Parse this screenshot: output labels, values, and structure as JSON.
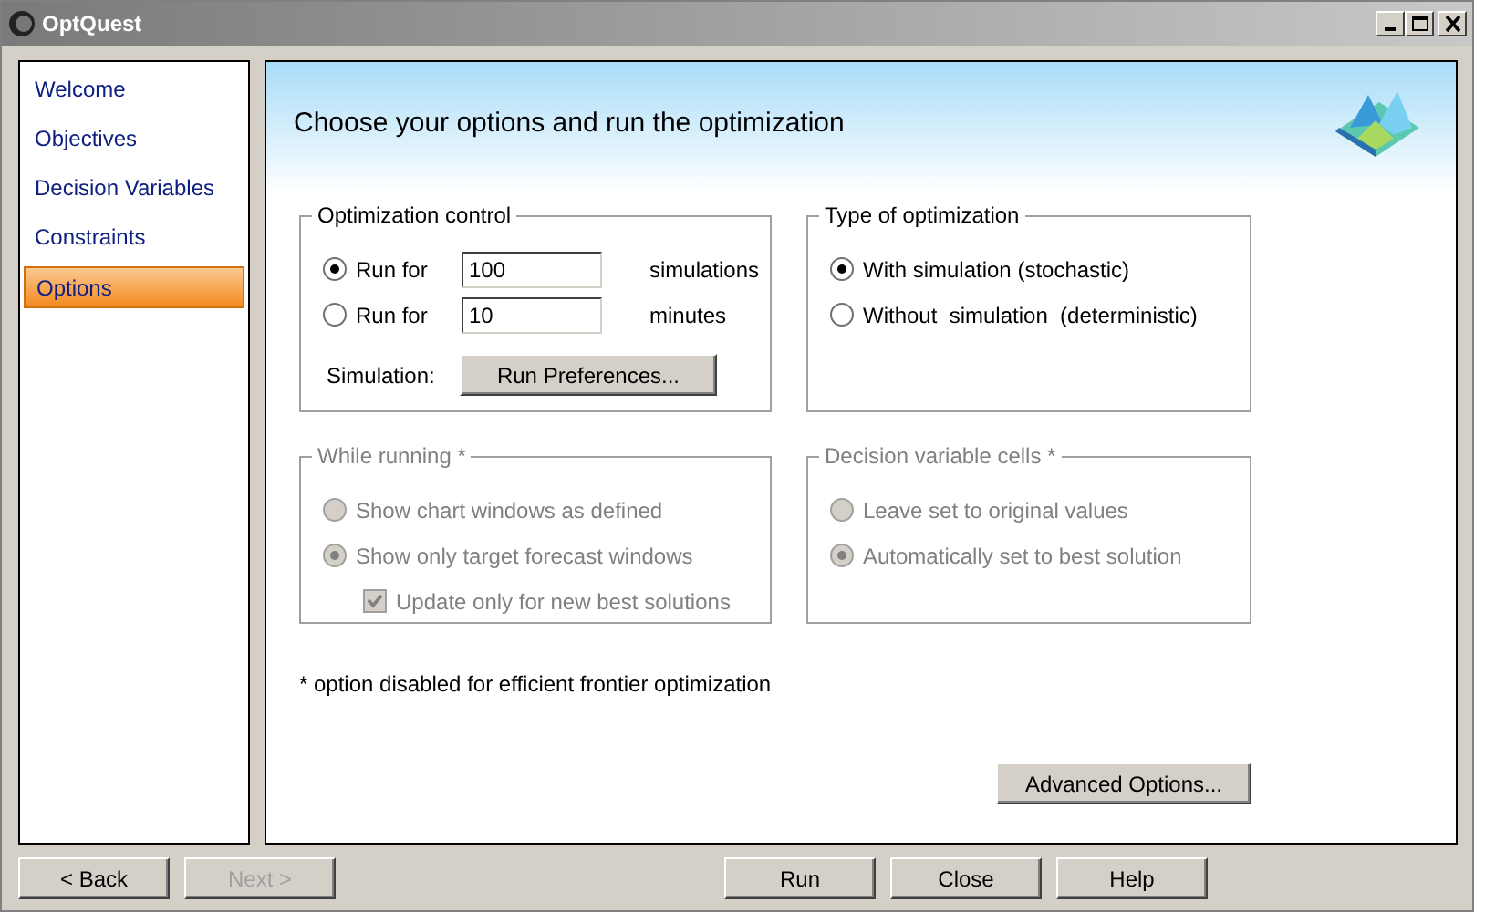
{
  "window": {
    "title": "OptQuest"
  },
  "sidebar": {
    "items": [
      {
        "label": "Welcome",
        "selected": false
      },
      {
        "label": "Objectives",
        "selected": false
      },
      {
        "label": "Decision Variables",
        "selected": false
      },
      {
        "label": "Constraints",
        "selected": false
      },
      {
        "label": "Options",
        "selected": true
      }
    ]
  },
  "header": {
    "title": "Choose your options and run the optimization"
  },
  "groups": [
    {
      "title": "Optimization control",
      "disabled": false,
      "rows": [
        {
          "kind": "radio-input",
          "label": "Run for",
          "selected": true,
          "value": "100",
          "unit": "simulations"
        },
        {
          "kind": "radio-input",
          "label": "Run for",
          "selected": false,
          "value": "10",
          "unit": "minutes"
        },
        {
          "kind": "button-row",
          "label": "Simulation:",
          "button": "Run Preferences..."
        }
      ]
    },
    {
      "title": "Type of optimization",
      "disabled": false,
      "rows": [
        {
          "kind": "radio",
          "label": "With simulation (stochastic)",
          "selected": true
        },
        {
          "kind": "radio",
          "label": "Without  simulation  (deterministic)",
          "selected": false
        }
      ]
    },
    {
      "title": "While running *",
      "disabled": true,
      "rows": [
        {
          "kind": "radio",
          "label": "Show chart windows as defined",
          "selected": false
        },
        {
          "kind": "radio",
          "label": "Show only target forecast windows",
          "selected": true
        },
        {
          "kind": "checkbox",
          "label": "Update only for new best solutions",
          "checked": true
        }
      ]
    },
    {
      "title": "Decision variable cells *",
      "disabled": true,
      "rows": [
        {
          "kind": "radio",
          "label": "Leave set to original values",
          "selected": false
        },
        {
          "kind": "radio",
          "label": "Automatically set to best solution",
          "selected": true
        }
      ]
    }
  ],
  "footnote": "* option disabled for efficient frontier optimization",
  "advanced_button": "Advanced Options...",
  "buttons": [
    {
      "label": "< Back",
      "disabled": false
    },
    {
      "label": "Next >",
      "disabled": true
    },
    {
      "label": "Run",
      "disabled": false
    },
    {
      "label": "Close",
      "disabled": false
    },
    {
      "label": "Help",
      "disabled": false
    }
  ]
}
